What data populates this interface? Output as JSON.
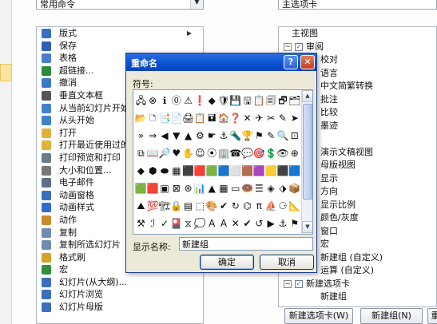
{
  "background": {
    "left_combo_value": "常用命令",
    "right_combo_value": "主选项卡",
    "commands": [
      {
        "label": "版式",
        "icon": "layout-icon",
        "color": "#3a6fc0",
        "submenu": true
      },
      {
        "label": "保存",
        "icon": "save-icon",
        "color": "#2f5fb3",
        "submenu": false
      },
      {
        "label": "表格",
        "icon": "table-icon",
        "color": "#4b7ecf",
        "submenu": true
      },
      {
        "label": "超链接...",
        "icon": "hyperlink-icon",
        "color": "#2c8a3a",
        "submenu": false
      },
      {
        "label": "撤消",
        "icon": "undo-icon",
        "color": "#3a78c8",
        "submenu": false
      },
      {
        "label": "垂直文本框",
        "icon": "vertical-textbox-icon",
        "color": "#555555",
        "submenu": false
      },
      {
        "label": "从当前幻灯片开始",
        "icon": "from-current-slide-icon",
        "color": "#3f82c9",
        "submenu": false
      },
      {
        "label": "从头开始",
        "icon": "from-beginning-icon",
        "color": "#3f82c9",
        "submenu": false
      },
      {
        "label": "打开",
        "icon": "open-folder-icon",
        "color": "#e0b23a",
        "submenu": false
      },
      {
        "label": "打开最近使用过的",
        "icon": "recent-files-icon",
        "color": "#e0b23a",
        "submenu": false
      },
      {
        "label": "打印预览和打印",
        "icon": "print-preview-icon",
        "color": "#6a7a8c",
        "submenu": false
      },
      {
        "label": "大小和位置...",
        "icon": "size-position-icon",
        "color": "#777777",
        "submenu": false
      },
      {
        "label": "电子邮件",
        "icon": "email-icon",
        "color": "#5d6f86",
        "submenu": false
      },
      {
        "label": "动画窗格",
        "icon": "animation-pane-icon",
        "color": "#3a6fc0",
        "submenu": false
      },
      {
        "label": "动画样式",
        "icon": "animation-style-icon",
        "color": "#2e6bd1",
        "submenu": false
      },
      {
        "label": "动作",
        "icon": "action-icon",
        "color": "#c98a2a",
        "submenu": false
      },
      {
        "label": "复制",
        "icon": "copy-icon",
        "color": "#6f8bb0",
        "submenu": false
      },
      {
        "label": "复制所选幻灯片",
        "icon": "duplicate-slide-icon",
        "color": "#6f8bb0",
        "submenu": false
      },
      {
        "label": "格式刷",
        "icon": "format-painter-icon",
        "color": "#d4a22a",
        "submenu": false
      },
      {
        "label": "宏",
        "icon": "macro-icon",
        "color": "#2f8f3c",
        "submenu": false
      },
      {
        "label": "幻灯片(从大纲)...",
        "icon": "slides-from-outline-icon",
        "color": "#3a6fc0",
        "submenu": false
      },
      {
        "label": "幻灯片浏览",
        "icon": "slide-sorter-icon",
        "color": "#3a6fc0",
        "submenu": false
      },
      {
        "label": "幻灯片母版",
        "icon": "slide-master-icon",
        "color": "#3a6fc0",
        "submenu": false
      }
    ],
    "tree": [
      {
        "text": "主视图",
        "indent": 16,
        "twisty": "",
        "checkbox": false
      },
      {
        "text": "审阅",
        "indent": 6,
        "twisty": "−",
        "checkbox": true
      },
      {
        "text": "校对",
        "indent": 52,
        "twisty": "",
        "checkbox": false
      },
      {
        "text": "语言",
        "indent": 52,
        "twisty": "",
        "checkbox": false
      },
      {
        "text": "中文简繁转换",
        "indent": 52,
        "twisty": "",
        "checkbox": false
      },
      {
        "text": "批注",
        "indent": 52,
        "twisty": "",
        "checkbox": false
      },
      {
        "text": "比较",
        "indent": 52,
        "twisty": "",
        "checkbox": false
      },
      {
        "text": "墨迹",
        "indent": 52,
        "twisty": "",
        "checkbox": false
      },
      {
        "text": "",
        "indent": 52,
        "twisty": "",
        "checkbox": false
      },
      {
        "text": "演示文稿视图",
        "indent": 52,
        "twisty": "",
        "checkbox": false
      },
      {
        "text": "母版视图",
        "indent": 52,
        "twisty": "",
        "checkbox": false
      },
      {
        "text": "显示",
        "indent": 52,
        "twisty": "",
        "checkbox": false
      },
      {
        "text": "方向",
        "indent": 52,
        "twisty": "",
        "checkbox": false
      },
      {
        "text": "显示比例",
        "indent": 52,
        "twisty": "",
        "checkbox": false
      },
      {
        "text": "颜色/灰度",
        "indent": 52,
        "twisty": "",
        "checkbox": false
      },
      {
        "text": "窗口",
        "indent": 52,
        "twisty": "",
        "checkbox": false
      },
      {
        "text": "宏",
        "indent": 52,
        "twisty": "",
        "checkbox": false
      },
      {
        "text": "新建组 (自定义)",
        "indent": 52,
        "twisty": "",
        "checkbox": false
      },
      {
        "text": "运算 (自定义)",
        "indent": 52,
        "twisty": "",
        "checkbox": false
      },
      {
        "text": "新建选项卡",
        "indent": 6,
        "twisty": "−",
        "checkbox": true
      },
      {
        "text": "新建组",
        "indent": 52,
        "twisty": "",
        "checkbox": false
      }
    ],
    "buttons": {
      "new_tab": "新建选项卡(W)",
      "new_group": "新建组(N)",
      "rename_partial": "重"
    }
  },
  "dialog": {
    "title": "重命名",
    "help": "?",
    "close": "✕",
    "symbol_label": "符号:",
    "display_name_label": "显示名称:",
    "display_name_value": "新建组",
    "ok": "确定",
    "cancel": "取消",
    "symbols": [
      "🖧",
      "⊗",
      "ℹ",
      "⓪",
      "⚠",
      "❗",
      "◆",
      "🛡",
      "💾",
      "🖫",
      "📋",
      "🗐",
      "🗗",
      "🗂",
      "📂",
      "🗅",
      "📑",
      "📄",
      "🖨",
      "📋",
      "🖬",
      "🏠",
      "❓",
      "✕",
      "✈",
      "✂",
      "✎",
      "➤",
      "»",
      "⇒",
      "◀",
      "▼",
      "▲",
      "⚙",
      "☛",
      "⚓",
      "🔦",
      "🏆",
      "⚑",
      "✎",
      "🔍",
      "⊡",
      "⧉",
      "📖",
      "🔎",
      "♥",
      "✋",
      "☺",
      "⦿",
      "🏢",
      "☎",
      "💬",
      "🎯",
      "💲",
      "👁",
      "⊕",
      "◆",
      "⬢",
      "⬬",
      "▦",
      "⬛",
      "🟥",
      "🟩",
      "🟦",
      "⬜",
      "🟫",
      "🟪",
      "🟨",
      "⬛",
      "🟦",
      "🟩",
      "🟥",
      "▣",
      "⊠",
      "⊛",
      "📊",
      "▲",
      "▦",
      "▭",
      "🍩",
      "☰",
      "◈",
      "⬗",
      "📦",
      "⛰",
      "💯",
      "🏗",
      "🔒",
      "▤",
      "⬚",
      "🎨",
      "✔",
      "↻",
      "⌬",
      "π",
      "⛵",
      "⚆",
      "📐",
      "⚒",
      "ℐ",
      "✓",
      "🎴",
      "⧖",
      "💭",
      "A",
      "A",
      "✕",
      "✔",
      "↺",
      "▶",
      "⚓",
      "⚑",
      "⚐",
      "⬆"
    ]
  }
}
